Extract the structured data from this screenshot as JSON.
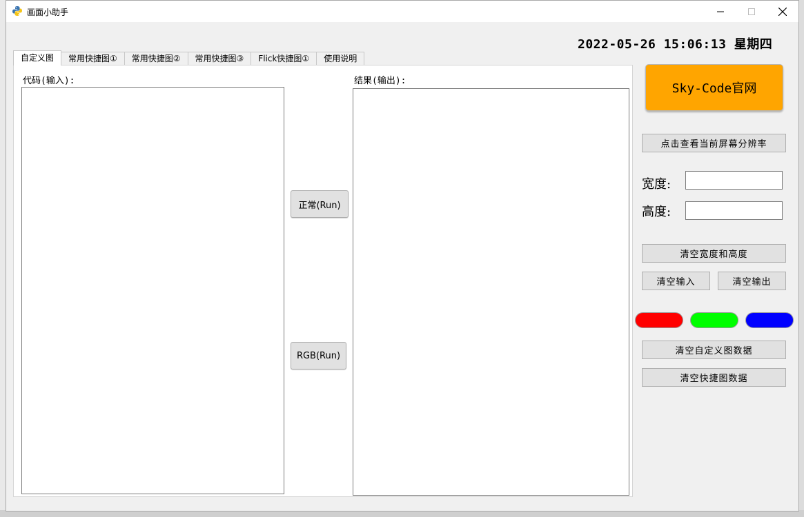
{
  "window": {
    "title": "画面小助手"
  },
  "datetime": "2022-05-26 15:06:13 星期四",
  "tabs": [
    {
      "label": "自定义图"
    },
    {
      "label": "常用快捷图①"
    },
    {
      "label": "常用快捷图②"
    },
    {
      "label": "常用快捷图③"
    },
    {
      "label": "Flick快捷图①"
    },
    {
      "label": "使用说明"
    }
  ],
  "editor": {
    "input_label": "代码(输入):",
    "output_label": "结果(输出):",
    "run_normal_label": "正常(Run)",
    "run_rgb_label": "RGB(Run)"
  },
  "side": {
    "website_label": "Sky-Code官网",
    "check_resolution_label": "点击查看当前屏幕分辨率",
    "width_label": "宽度:",
    "height_label": "高度:",
    "clear_size_label": "清空宽度和高度",
    "clear_input_label": "清空输入",
    "clear_output_label": "清空输出",
    "clear_custom_label": "清空自定义图数据",
    "clear_shortcut_label": "清空快捷图数据"
  },
  "colors": {
    "accent": "#ffa500",
    "red": "#ff0000",
    "green": "#00ff00",
    "blue": "#0000ff"
  }
}
